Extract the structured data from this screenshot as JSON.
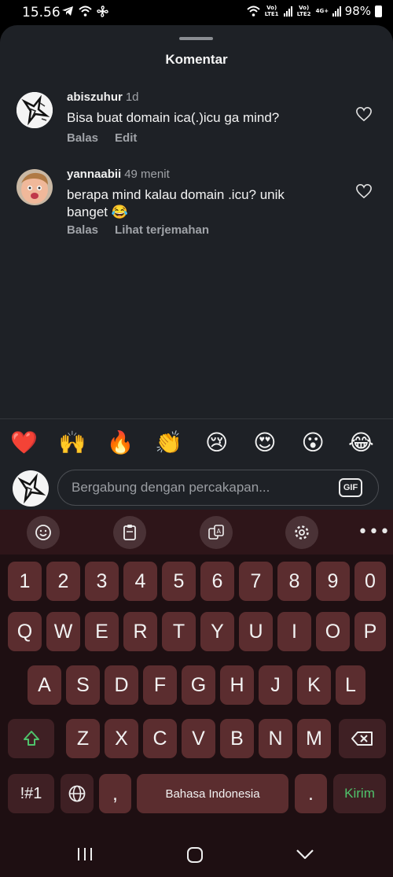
{
  "status_bar": {
    "time": "15.56",
    "sim1_label": "Vo) LTE1",
    "sim2_label": "Vo) LTE2",
    "network": "4G+",
    "battery": "98%"
  },
  "sheet": {
    "title": "Komentar"
  },
  "comments": [
    {
      "username": "abiszuhur",
      "time": "1d",
      "text": "Bisa buat domain ica(.)icu ga mind?",
      "actions": [
        "Balas",
        "Edit"
      ]
    },
    {
      "username": "yannaabii",
      "time": "49 menit",
      "text": "berapa mind kalau domain .icu? unik banget 😂",
      "actions": [
        "Balas",
        "Lihat terjemahan"
      ]
    }
  ],
  "emoji_bar": [
    "❤️",
    "🙌",
    "🔥",
    "👏",
    "😢",
    "😍",
    "😮",
    "😂"
  ],
  "composer": {
    "placeholder": "Bergabung dengan percakapan...",
    "gif_label": "GIF"
  },
  "keyboard": {
    "toolbar_icons": [
      "emoji-icon",
      "clipboard-icon",
      "translate-icon",
      "settings-icon",
      "more-icon"
    ],
    "more_label": "•••",
    "row_numbers": [
      "1",
      "2",
      "3",
      "4",
      "5",
      "6",
      "7",
      "8",
      "9",
      "0"
    ],
    "row1": [
      "Q",
      "W",
      "E",
      "R",
      "T",
      "Y",
      "U",
      "I",
      "O",
      "P"
    ],
    "row2": [
      "A",
      "S",
      "D",
      "F",
      "G",
      "H",
      "J",
      "K",
      "L"
    ],
    "row3": [
      "Z",
      "X",
      "C",
      "V",
      "B",
      "N",
      "M"
    ],
    "symbols_label": "!#1",
    "comma_label": ",",
    "space_label": "Bahasa Indonesia",
    "period_label": ".",
    "send_label": "Kirim"
  },
  "colors": {
    "sheet_bg": "#1e2126",
    "key_bg": "#5b2d2f",
    "send_text": "#4fc36b"
  }
}
